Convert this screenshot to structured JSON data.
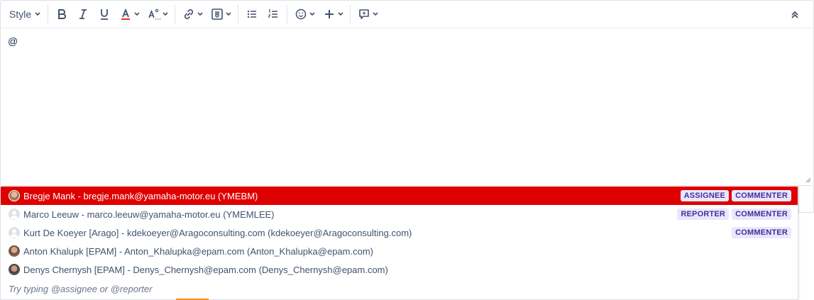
{
  "toolbar": {
    "style_label": "Style",
    "buttons": [
      "bold-icon",
      "italic-icon",
      "underline-icon",
      "text-color-icon",
      "text-effects-icon",
      "link-icon",
      "attachment-icon",
      "bullet-list-icon",
      "numbered-list-icon",
      "emoji-icon",
      "insert-plus-icon",
      "comment-icon",
      "collapse-icon"
    ],
    "text_color_accent": "#de350b"
  },
  "editor": {
    "content": "@"
  },
  "mentions": {
    "selected_color": "#de0000",
    "items": [
      {
        "text": "Bregje Mank - bregje.mank@yamaha-motor.eu (YMEBM)",
        "avatar": "photo",
        "badges": [
          "ASSIGNEE",
          "COMMENTER"
        ],
        "selected": true
      },
      {
        "text": "Marco Leeuw - marco.leeuw@yamaha-motor.eu (YMEMLEE)",
        "avatar": "default",
        "badges": [
          "REPORTER",
          "COMMENTER"
        ],
        "selected": false
      },
      {
        "text": "Kurt De Koeyer [Arago] - kdekoeyer@Aragoconsulting.com (kdekoeyer@Aragoconsulting.com)",
        "avatar": "default",
        "badges": [
          "COMMENTER"
        ],
        "selected": false
      },
      {
        "text": "Anton Khalupk [EPAM] - Anton_Khalupka@epam.com (Anton_Khalupka@epam.com)",
        "avatar": "photo",
        "badges": [],
        "selected": false
      },
      {
        "text": "Denys Chernysh [EPAM] - Denys_Chernysh@epam.com (Denys_Chernysh@epam.com)",
        "avatar": "photo",
        "badges": [],
        "selected": false
      }
    ],
    "hint": "Try typing @assignee or @reporter"
  }
}
